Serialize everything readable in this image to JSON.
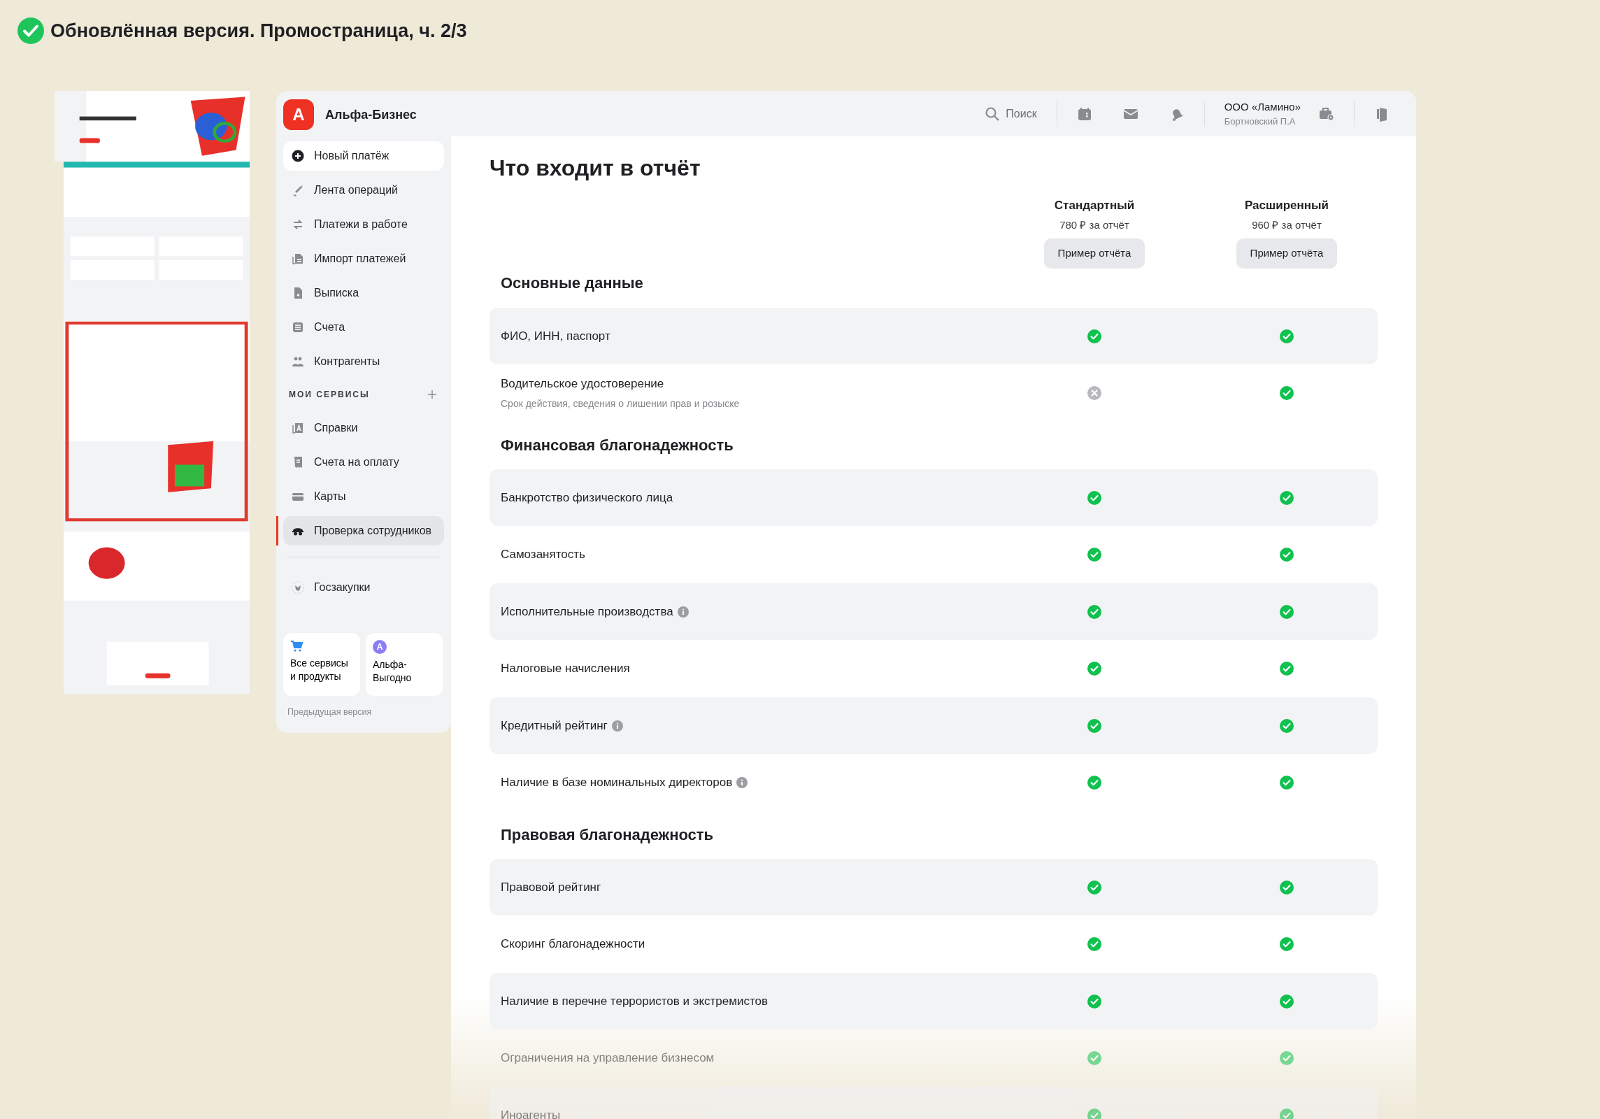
{
  "caption": {
    "title": "Обновлённая версия. Промостраница, ч. 2/3"
  },
  "sidebar": {
    "brand": "Альфа-Бизнес",
    "logo_letter": "А",
    "items": [
      {
        "label": "Новый платёж",
        "kind": "action"
      },
      {
        "label": "Лента операций",
        "kind": "link",
        "selected": false
      },
      {
        "label": "Платежи в работе",
        "kind": "link",
        "selected": false
      },
      {
        "label": "Импорт платежей",
        "kind": "link",
        "selected": false
      },
      {
        "label": "Выписка",
        "kind": "link",
        "selected": false
      },
      {
        "label": "Счета",
        "kind": "link",
        "selected": false
      },
      {
        "label": "Контрагенты",
        "kind": "link",
        "selected": false
      },
      {
        "label": "МОИ СЕРВИСЫ",
        "kind": "section"
      },
      {
        "label": "Справки",
        "kind": "link",
        "selected": false
      },
      {
        "label": "Счета на оплату",
        "kind": "link",
        "selected": false
      },
      {
        "label": "Карты",
        "kind": "link",
        "selected": false
      },
      {
        "label": "Проверка сотрудников",
        "kind": "link",
        "selected": true
      },
      {
        "label": "Госзакупки",
        "kind": "link",
        "selected": false
      }
    ],
    "tiles": [
      {
        "label": "Все сервисы и продукты"
      },
      {
        "label": "Альфа-Выгодно",
        "badge": "A"
      }
    ],
    "footer": "Предыдущая версия"
  },
  "header": {
    "search": "Поиск",
    "company": "ООО «Ламино»",
    "user": "Бортновский П.А"
  },
  "report": {
    "title": "Что входит в отчёт",
    "plans": [
      {
        "name": "Стандартный",
        "price": "780 ₽ за отчёт",
        "button": "Пример отчёта"
      },
      {
        "name": "Расширенный",
        "price": "960 ₽ за отчёт",
        "button": "Пример отчёта"
      }
    ],
    "sections": [
      {
        "title": "Основные данные",
        "rows": [
          {
            "label": "ФИО, ИНН, паспорт",
            "standard": true,
            "extended": true
          },
          {
            "label": "Водительское удостоверение",
            "note": "Срок действия, сведения о лишении прав и розыске",
            "standard": false,
            "extended": true
          }
        ]
      },
      {
        "title": "Финансовая благонадежность",
        "rows": [
          {
            "label": "Банкротство физического лица",
            "standard": true,
            "extended": true
          },
          {
            "label": "Самозанятость",
            "standard": true,
            "extended": true
          },
          {
            "label": "Исполнительные производства",
            "info": true,
            "standard": true,
            "extended": true
          },
          {
            "label": "Налоговые начисления",
            "standard": true,
            "extended": true
          },
          {
            "label": "Кредитный рейтинг",
            "info": true,
            "standard": true,
            "extended": true
          },
          {
            "label": "Наличие в базе номинальных директоров",
            "info": true,
            "standard": true,
            "extended": true
          }
        ]
      },
      {
        "title": "Правовая благонадежность",
        "rows": [
          {
            "label": "Правовой рейтинг",
            "standard": true,
            "extended": true
          },
          {
            "label": "Скоринг благонадежности",
            "standard": true,
            "extended": true
          },
          {
            "label": "Наличие в перечне террористов и экстремистов",
            "standard": true,
            "extended": true
          },
          {
            "label": "Ограничения на управление бизнесом",
            "faded": true,
            "standard": true,
            "extended": true
          },
          {
            "label": "Иноагенты",
            "faded": true,
            "standard": true,
            "extended": true
          }
        ]
      }
    ]
  }
}
